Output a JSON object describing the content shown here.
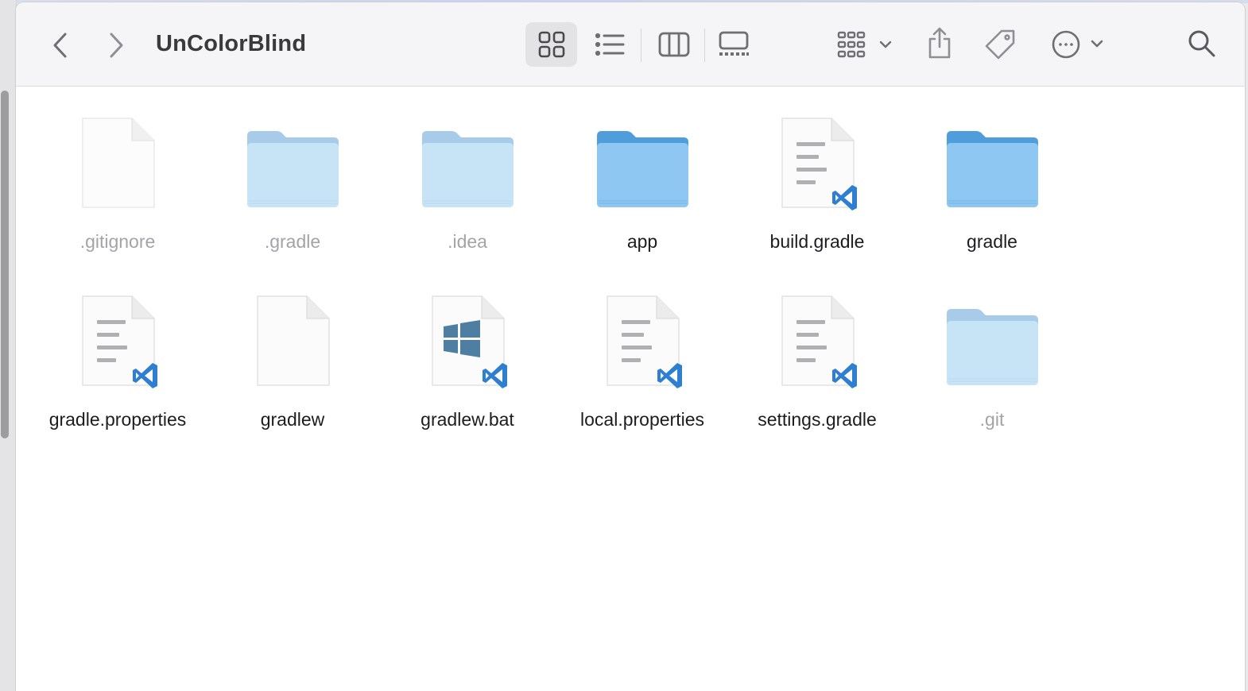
{
  "window": {
    "title": "UnColorBlind"
  },
  "toolbar": {
    "back": "chevron-left-icon",
    "forward": "chevron-right-icon",
    "view_modes": [
      "icon-view-icon",
      "list-view-icon",
      "column-view-icon",
      "gallery-view-icon"
    ],
    "active_view": "icon-view-icon",
    "group": "group-by-icon",
    "share": "share-icon",
    "tags": "tag-icon",
    "more": "more-actions-icon",
    "search": "search-icon"
  },
  "files": [
    {
      "name": ".gitignore",
      "kind": "blank-doc",
      "hidden": true
    },
    {
      "name": ".gradle",
      "kind": "folder",
      "hidden": true
    },
    {
      "name": ".idea",
      "kind": "folder",
      "hidden": true
    },
    {
      "name": "app",
      "kind": "folder",
      "hidden": false
    },
    {
      "name": "build.gradle",
      "kind": "vscode-doc",
      "hidden": false
    },
    {
      "name": "gradle",
      "kind": "folder",
      "hidden": false
    },
    {
      "name": "gradle.properties",
      "kind": "vscode-doc",
      "hidden": false
    },
    {
      "name": "gradlew",
      "kind": "blank-doc",
      "hidden": false
    },
    {
      "name": "gradlew.bat",
      "kind": "vscode-windows-doc",
      "hidden": false
    },
    {
      "name": "local.properties",
      "kind": "vscode-doc",
      "hidden": false
    },
    {
      "name": "settings.gradle",
      "kind": "vscode-doc",
      "hidden": false
    },
    {
      "name": ".git",
      "kind": "folder",
      "hidden": true
    }
  ],
  "colors": {
    "folder_front": "#8ec8f2",
    "folder_back": "#4f9ddb",
    "folder_hidden_front": "#c7e4f7",
    "folder_hidden_back": "#a8cbea",
    "vscode_blue": "#2f7fd1"
  }
}
